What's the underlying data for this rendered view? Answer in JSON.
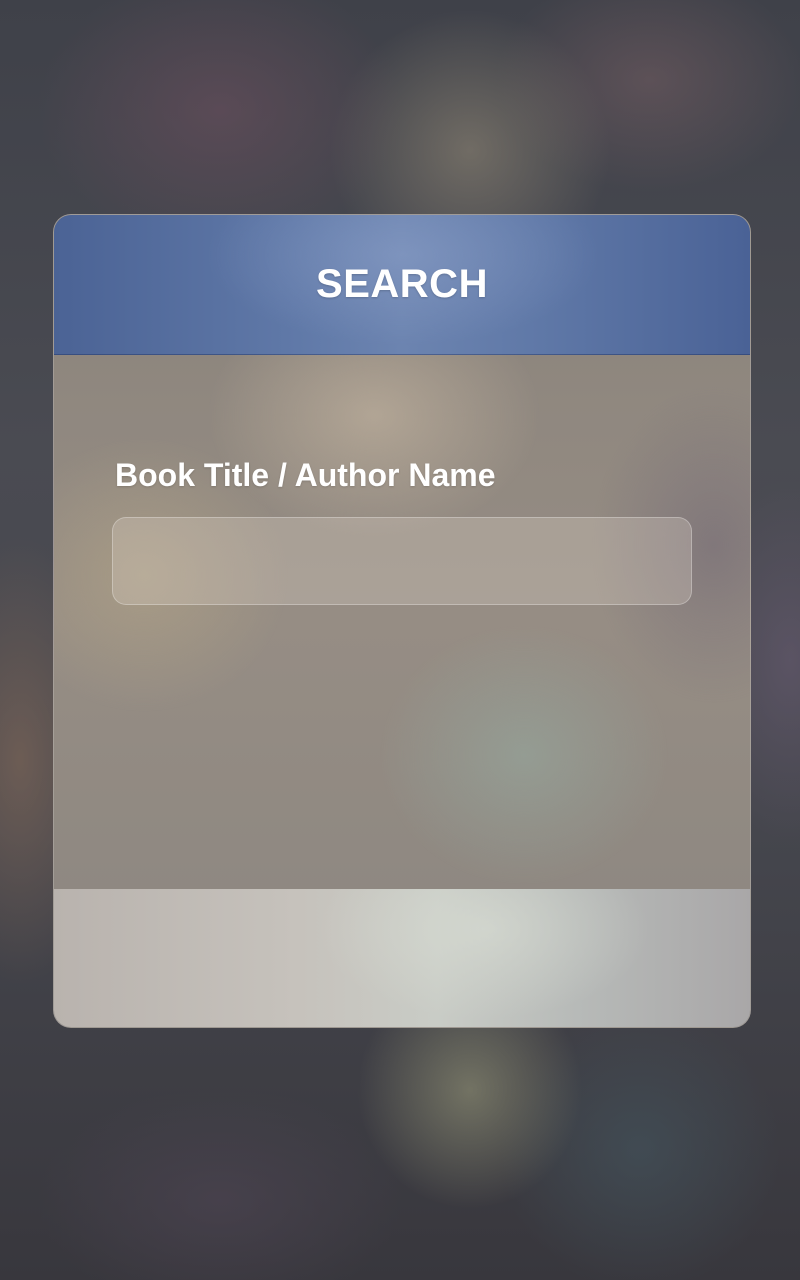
{
  "search_panel": {
    "title": "SEARCH",
    "field_label": "Book Title / Author Name",
    "input_value": "",
    "input_placeholder": ""
  }
}
